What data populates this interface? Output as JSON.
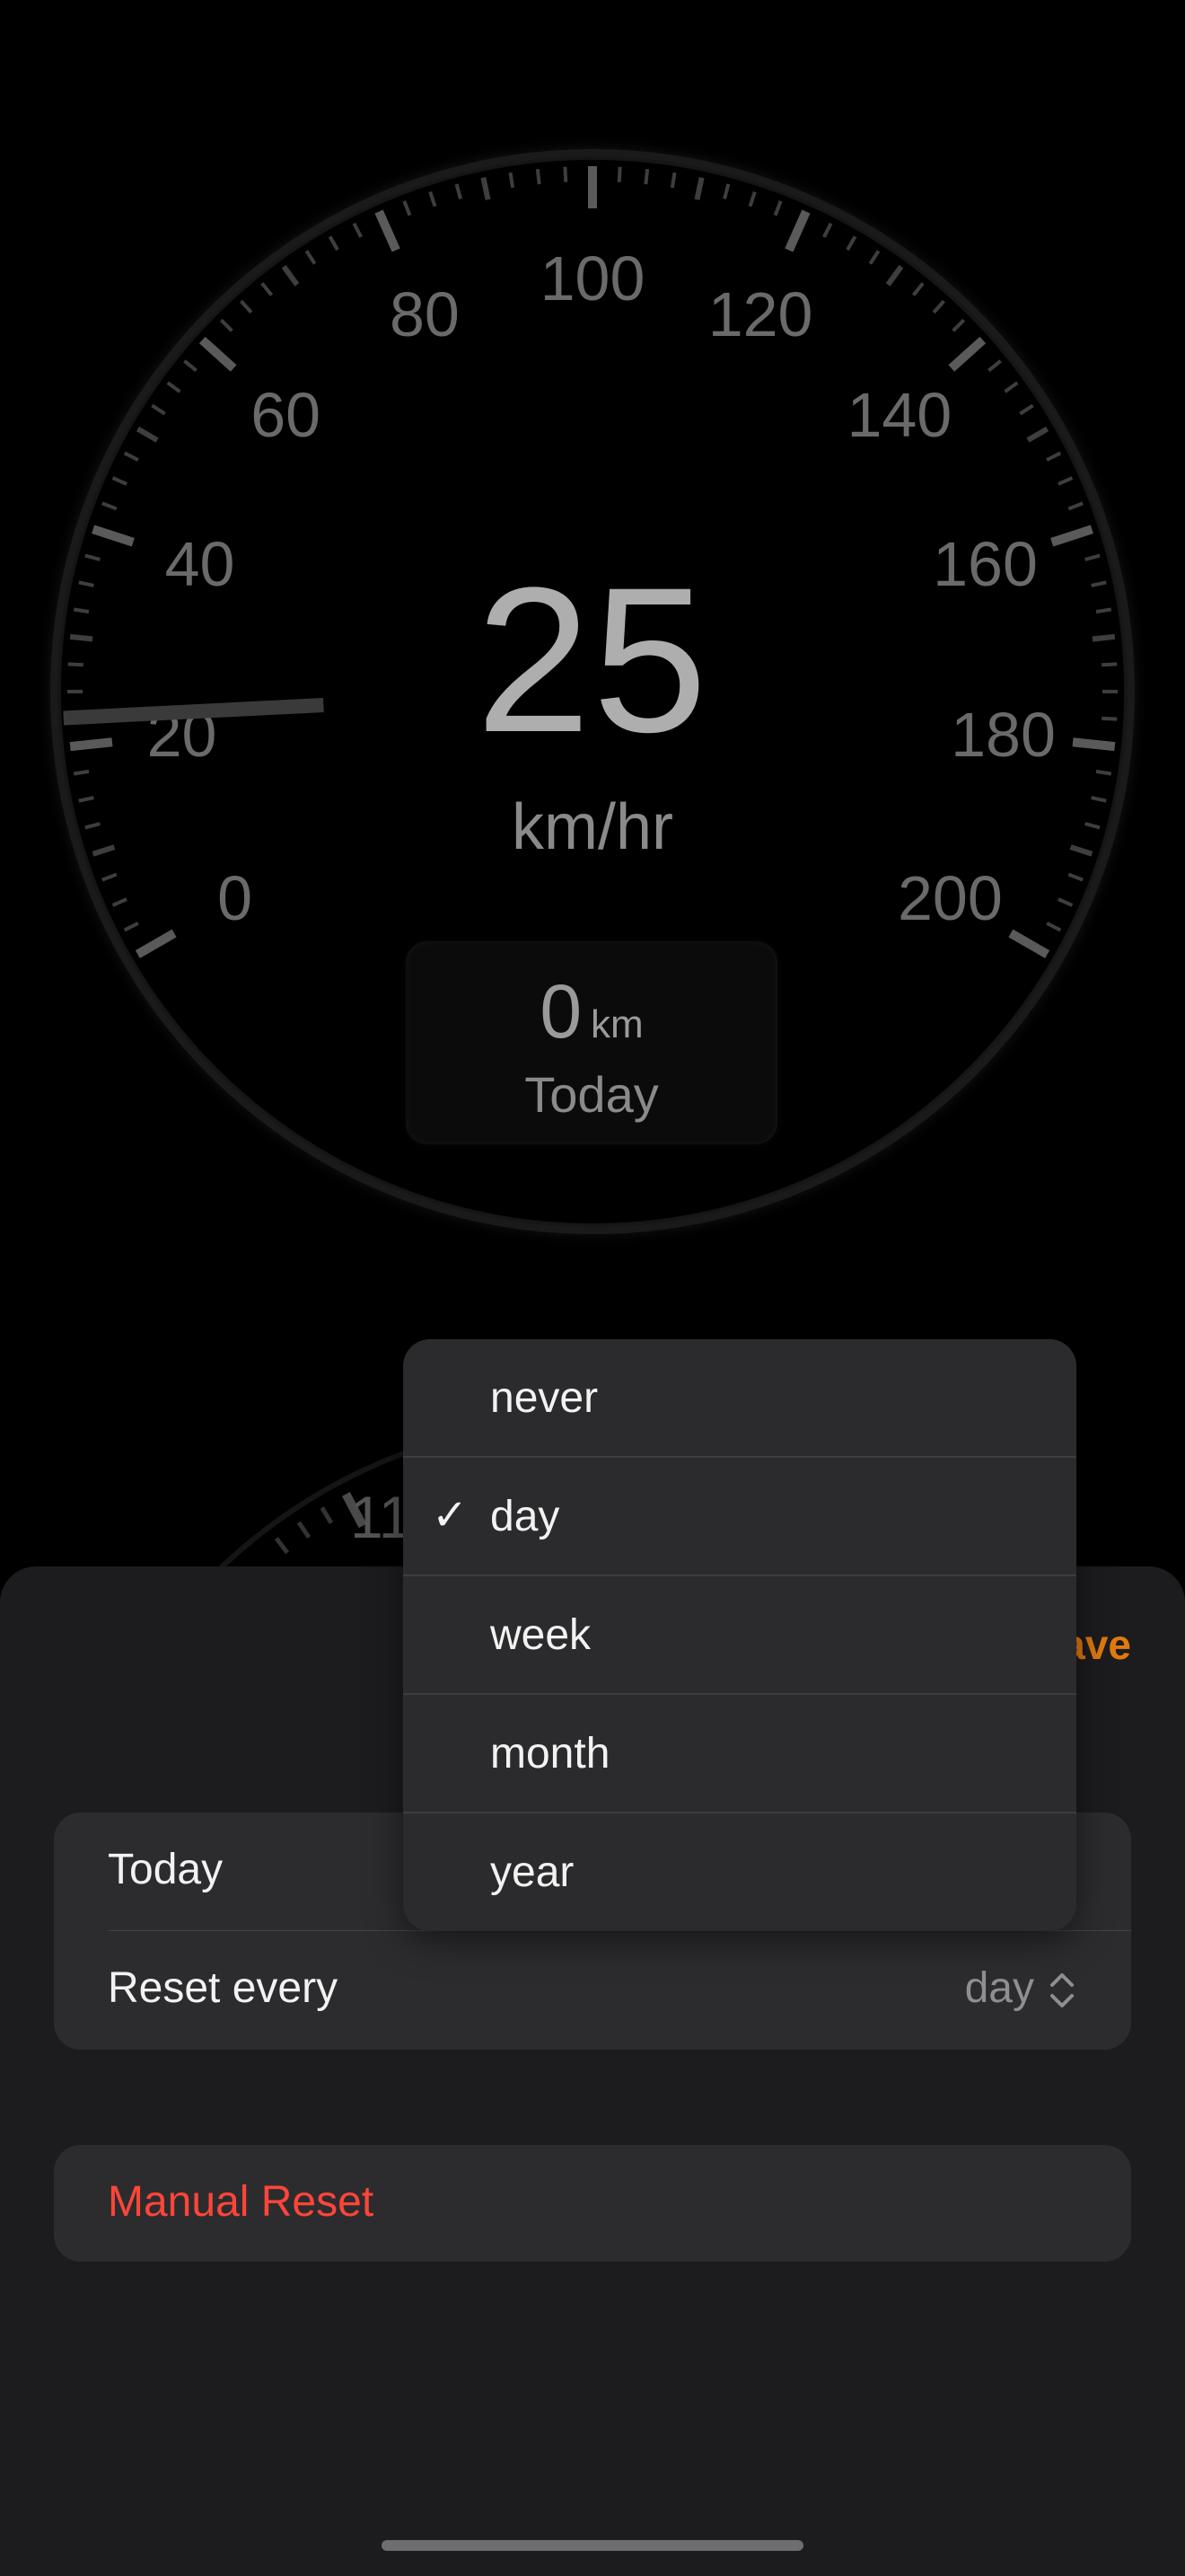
{
  "gauge": {
    "speed": "25",
    "unit": "km/hr",
    "needle_speed": 25,
    "scale_labels": [
      "0",
      "20",
      "40",
      "60",
      "80",
      "100",
      "120",
      "140",
      "160",
      "180",
      "200"
    ],
    "odometer": {
      "value": "0",
      "unit": "km",
      "label": "Today"
    },
    "needle_color_start": "#c0302a",
    "needle_color_end": "#d4890e",
    "tick_color": "#555555",
    "label_color": "#6a6a6a"
  },
  "background_gauge": {
    "partial_label": "11"
  },
  "sheet": {
    "save_label": "ave",
    "today_label": "Today",
    "reset_every_label": "Reset every",
    "reset_every_value": "day",
    "manual_reset_label": "Manual Reset",
    "accent_color": "#e07a0f",
    "destructive_color": "#ff453a"
  },
  "menu": {
    "items": [
      {
        "label": "never",
        "selected": false
      },
      {
        "label": "day",
        "selected": true
      },
      {
        "label": "week",
        "selected": false
      },
      {
        "label": "month",
        "selected": false
      },
      {
        "label": "year",
        "selected": false
      }
    ],
    "check_glyph": "✓"
  }
}
